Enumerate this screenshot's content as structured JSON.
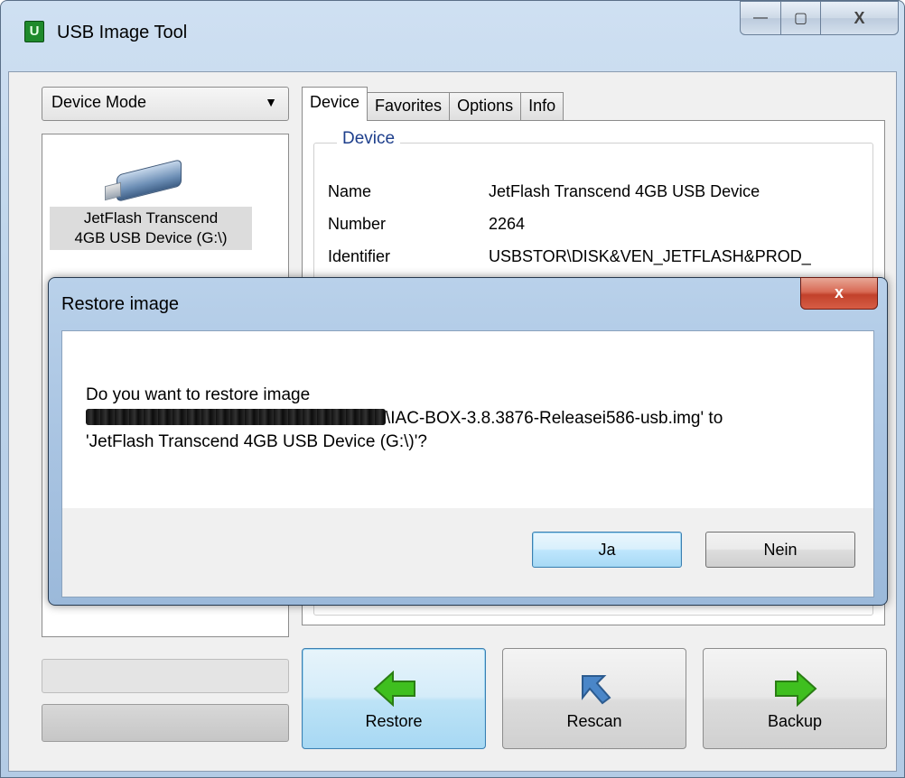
{
  "window": {
    "title": "USB Image Tool",
    "icon_letter": "U",
    "minimize_glyph": "—",
    "maximize_glyph": "▢",
    "close_glyph": "X"
  },
  "left": {
    "mode_select_value": "Device Mode",
    "dropdown_arrow": "▼",
    "devices": [
      {
        "label_line1": "JetFlash Transcend",
        "label_line2": "4GB USB Device (G:\\)"
      }
    ]
  },
  "tabs": [
    {
      "label": "Device",
      "active": true
    },
    {
      "label": "Favorites",
      "active": false
    },
    {
      "label": "Options",
      "active": false
    },
    {
      "label": "Info",
      "active": false
    }
  ],
  "device_group": {
    "title": "Device",
    "rows": [
      {
        "key": "Name",
        "value": "JetFlash Transcend 4GB USB Device"
      },
      {
        "key": "Number",
        "value": "2264"
      },
      {
        "key": "Identifier",
        "value": "USBSTOR\\DISK&VEN_JETFLASH&PROD_"
      }
    ]
  },
  "buttons": {
    "restore": "Restore",
    "rescan": "Rescan",
    "backup": "Backup"
  },
  "dialog": {
    "title": "Restore image",
    "close_glyph": "x",
    "message_line1": "Do you want to restore image",
    "message_line2_suffix": "\\IAC-BOX-3.8.3876-Releasei586-usb.img' to",
    "message_line3": "'JetFlash Transcend 4GB USB Device (G:\\)'?",
    "yes_label": "Ja",
    "no_label": "Nein"
  },
  "colors": {
    "group_title": "#1e3f8c",
    "arrow_green": "#3fbf1f",
    "rescan_blue": "#4a86c8",
    "dialog_close_red": "#c2412b"
  }
}
